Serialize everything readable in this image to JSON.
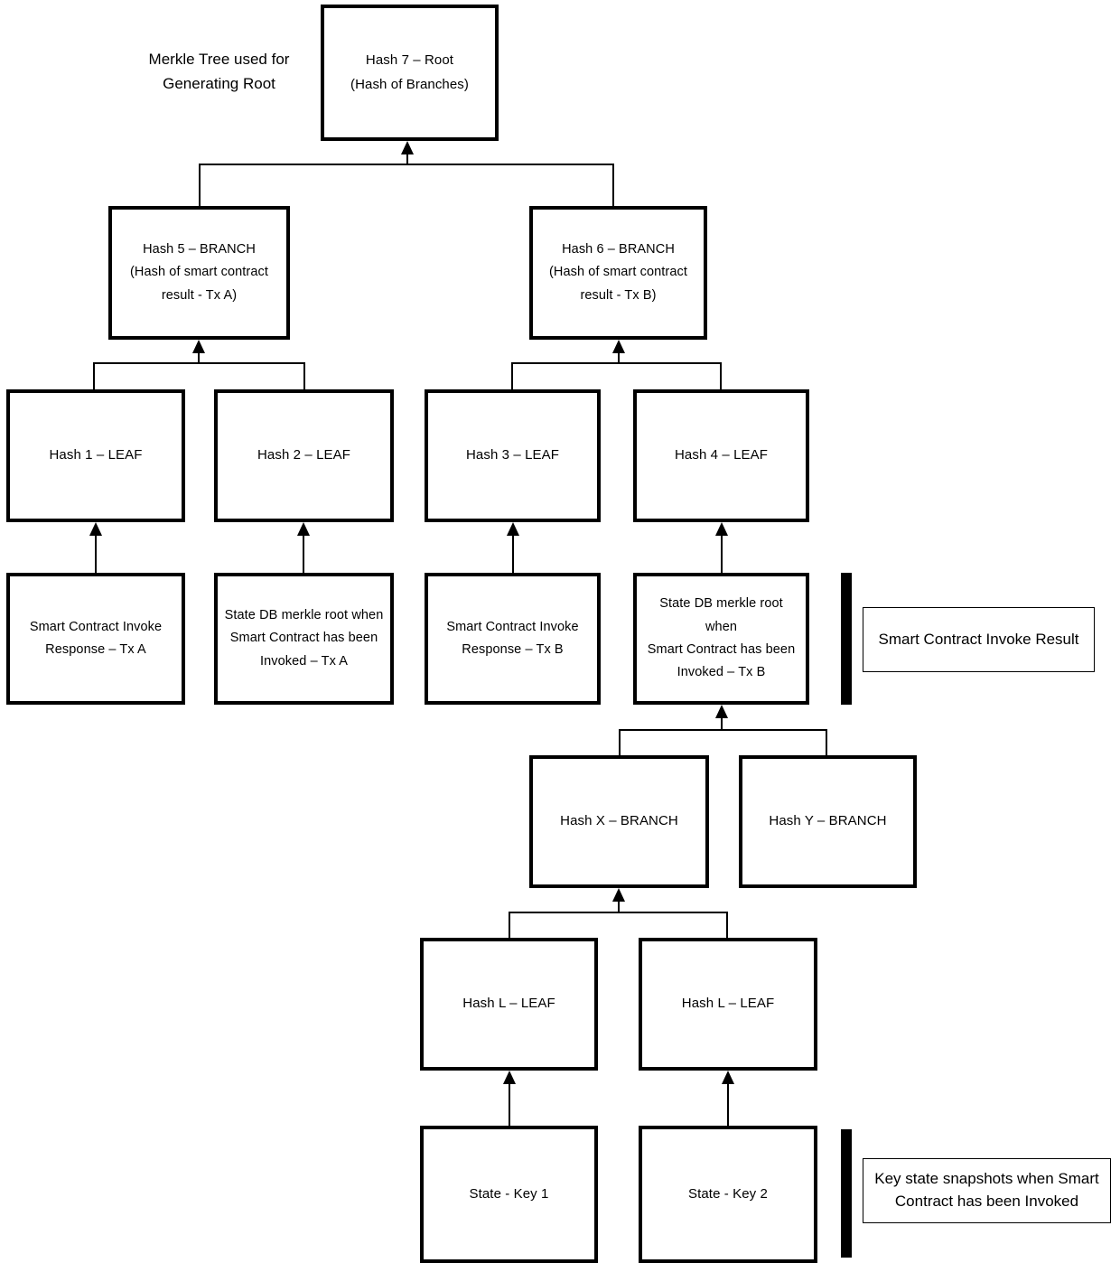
{
  "diagram": {
    "caption": "Merkle Tree used for\nGenerating Root",
    "nodes": {
      "root": "Hash 7  –  Root\n(Hash of Branches)",
      "branch5": "Hash 5  –  BRANCH\n(Hash of smart contract\nresult - Tx A)",
      "branch6": "Hash 6  –  BRANCH\n(Hash of smart contract\nresult - Tx B)",
      "leaf1": "Hash 1  –  LEAF",
      "leaf2": "Hash 2  –  LEAF",
      "leaf3": "Hash 3  –  LEAF",
      "leaf4": "Hash 4  –  LEAF",
      "data1": "Smart Contract Invoke\nResponse  –  Tx A",
      "data2": "State DB merkle root when\nSmart Contract has been\nInvoked  –  Tx A",
      "data3": "Smart Contract Invoke\nResponse  –  Tx B",
      "data4": "State DB merkle root when\nSmart Contract has been\nInvoked  –  Tx B",
      "branchX": "Hash X  –  BRANCH",
      "branchY": "Hash Y  –  BRANCH",
      "leafL1": "Hash L  –  LEAF",
      "leafL2": "Hash L  –  LEAF",
      "state1": "State - Key 1",
      "state2": "State - Key 2"
    },
    "legends": {
      "invoke_result": "Smart Contract Invoke Result",
      "key_state": "Key state snapshots when Smart\nContract has been Invoked"
    },
    "colors": {
      "stroke": "#000000",
      "fill": "#ffffff",
      "text": "#000000"
    }
  }
}
